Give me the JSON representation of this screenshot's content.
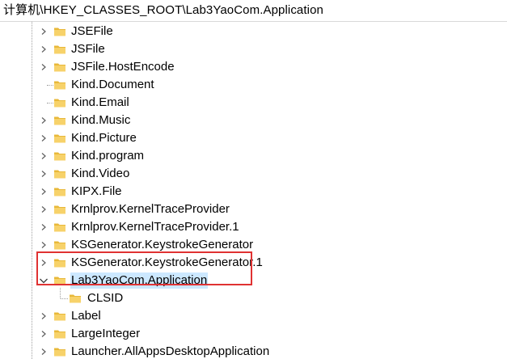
{
  "address_bar": {
    "path": "计算机\\HKEY_CLASSES_ROOT\\Lab3YaoCom.Application"
  },
  "tree": {
    "items": [
      {
        "label": "JSEFile",
        "toggle": "collapsed"
      },
      {
        "label": "JSFile",
        "toggle": "collapsed"
      },
      {
        "label": "JSFile.HostEncode",
        "toggle": "collapsed"
      },
      {
        "label": "Kind.Document",
        "toggle": "none"
      },
      {
        "label": "Kind.Email",
        "toggle": "none"
      },
      {
        "label": "Kind.Music",
        "toggle": "collapsed"
      },
      {
        "label": "Kind.Picture",
        "toggle": "collapsed"
      },
      {
        "label": "Kind.program",
        "toggle": "collapsed"
      },
      {
        "label": "Kind.Video",
        "toggle": "collapsed"
      },
      {
        "label": "KIPX.File",
        "toggle": "collapsed"
      },
      {
        "label": "Krnlprov.KernelTraceProvider",
        "toggle": "collapsed"
      },
      {
        "label": "Krnlprov.KernelTraceProvider.1",
        "toggle": "collapsed"
      },
      {
        "label": "KSGenerator.KeystrokeGenerator",
        "toggle": "collapsed"
      },
      {
        "label": "KSGenerator.KeystrokeGenerator.1",
        "toggle": "collapsed"
      },
      {
        "label": "Lab3YaoCom.Application",
        "toggle": "expanded",
        "selected": true
      },
      {
        "label": "CLSID",
        "toggle": "none",
        "child": true
      },
      {
        "label": "Label",
        "toggle": "collapsed"
      },
      {
        "label": "LargeInteger",
        "toggle": "collapsed"
      },
      {
        "label": "Launcher.AllAppsDesktopApplication",
        "toggle": "collapsed"
      }
    ]
  },
  "colors": {
    "folder": "#e8b839",
    "folder_light": "#f7d26a",
    "selection": "#cce8ff",
    "highlight_box": "#e03232",
    "tree_line": "#a0a0a0"
  },
  "icons": {
    "folder": "folder-icon",
    "collapsed": "chevron-right-icon",
    "expanded": "chevron-down-icon"
  }
}
